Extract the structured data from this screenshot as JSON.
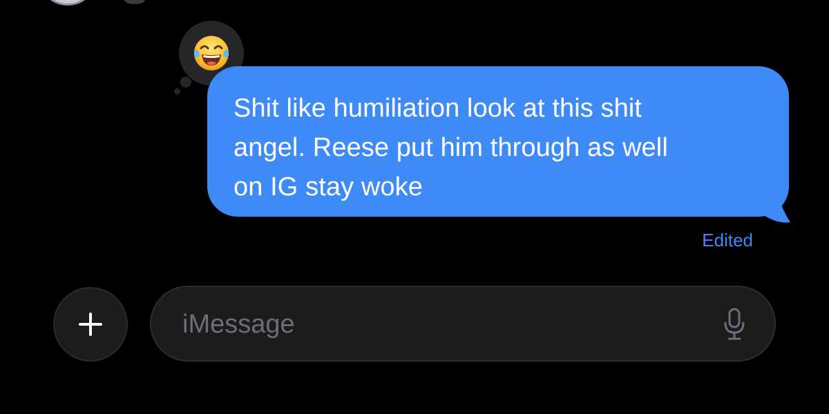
{
  "conversation": {
    "reaction": {
      "emoji": "😂",
      "icon": "face-with-tears-of-joy-icon"
    },
    "message": {
      "text": "Shit  like humiliation look at this shit\nangel. Reese put him through as well\non IG stay woke",
      "status": "Edited",
      "bubble_color": "#3e8af7"
    }
  },
  "composer": {
    "add_button_icon": "plus-icon",
    "placeholder": "iMessage",
    "mic_icon": "microphone-icon"
  },
  "colors": {
    "background": "#000000",
    "accent": "#3e8af7",
    "input_bg": "#1c1c1e",
    "placeholder": "#6e6e73"
  }
}
